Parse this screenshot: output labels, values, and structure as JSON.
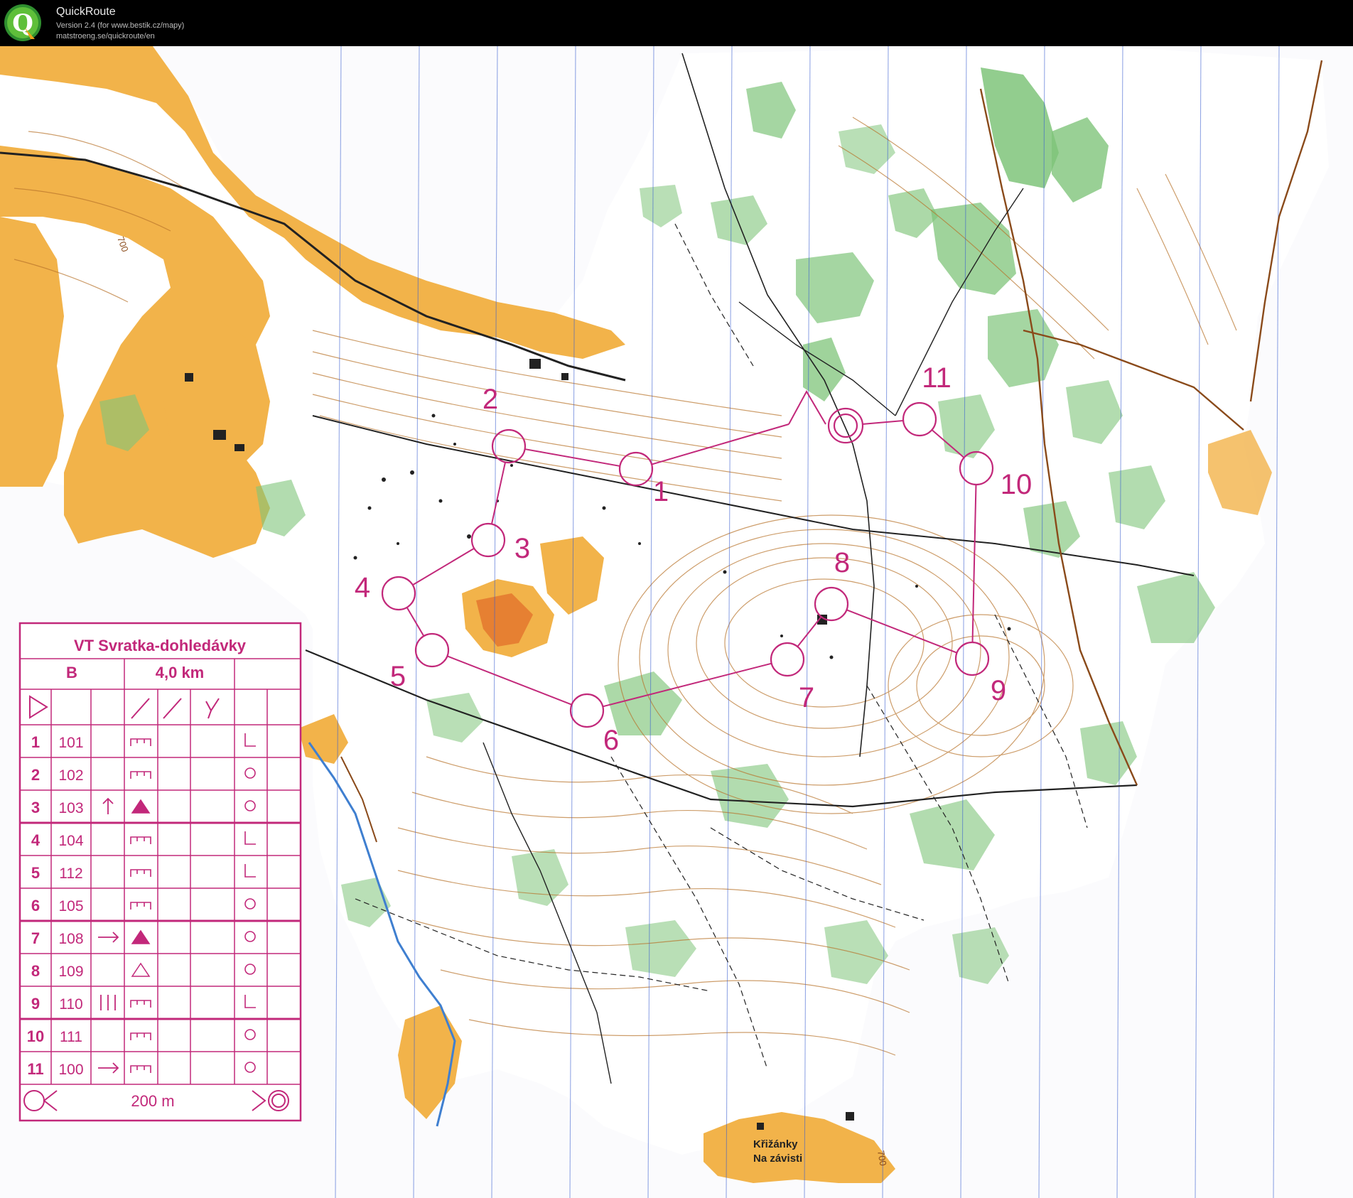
{
  "app": {
    "name": "QuickRoute",
    "version_line": "Version 2.4  (for www.bestik.cz/mapy)",
    "url_line": "matstroeng.se/quickroute/en",
    "logo_letter": "Q"
  },
  "map": {
    "contour_labels": [
      "700",
      "700"
    ],
    "place_name_line1": "Křižánky",
    "place_name_line2": "Na závisti",
    "colors": {
      "open_land": "#f2b34a",
      "forest": "#7fc47a",
      "course": "#c2287a",
      "water": "#3f7fd0",
      "road": "#222222",
      "contour": "#b8742c",
      "north_lines": "#3a5fd0"
    }
  },
  "course": {
    "controls": [
      {
        "number": "1"
      },
      {
        "number": "2"
      },
      {
        "number": "3"
      },
      {
        "number": "4"
      },
      {
        "number": "5"
      },
      {
        "number": "6"
      },
      {
        "number": "7"
      },
      {
        "number": "8"
      },
      {
        "number": "9"
      },
      {
        "number": "10"
      },
      {
        "number": "11"
      }
    ]
  },
  "legend": {
    "title": "VT Svratka-dohledávky",
    "class_name": "B",
    "length": "4,0 km",
    "rows": [
      {
        "num": "1",
        "code": "101"
      },
      {
        "num": "2",
        "code": "102"
      },
      {
        "num": "3",
        "code": "103"
      },
      {
        "num": "4",
        "code": "104"
      },
      {
        "num": "5",
        "code": "112"
      },
      {
        "num": "6",
        "code": "105"
      },
      {
        "num": "7",
        "code": "108"
      },
      {
        "num": "8",
        "code": "109"
      },
      {
        "num": "9",
        "code": "110"
      },
      {
        "num": "10",
        "code": "111"
      },
      {
        "num": "11",
        "code": "100"
      }
    ],
    "finish_text": "200 m"
  }
}
